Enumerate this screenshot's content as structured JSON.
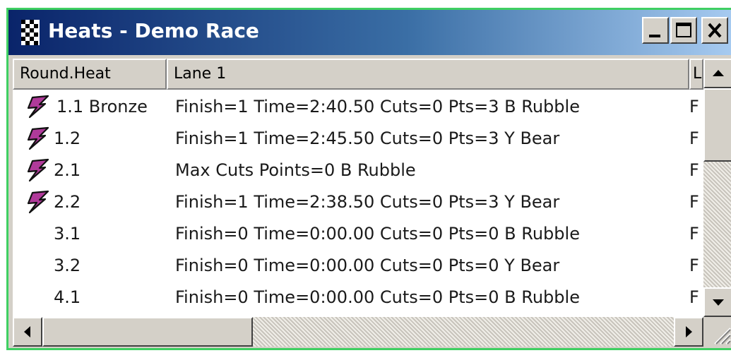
{
  "window": {
    "title": "Heats - Demo Race"
  },
  "columns": [
    "Round.Heat",
    "Lane 1",
    "L"
  ],
  "rows": [
    {
      "round_heat": "1.1 Bronze",
      "lane1": "Finish=1 Time=2:40.50 Cuts=0 Pts=3 B Rubble",
      "lane2": "F",
      "has_icon": true
    },
    {
      "round_heat": "1.2",
      "lane1": "Finish=1 Time=2:45.50 Cuts=0 Pts=3 Y Bear",
      "lane2": "F",
      "has_icon": true
    },
    {
      "round_heat": "2.1",
      "lane1": "Max Cuts  Points=0 B Rubble",
      "lane2": "F",
      "has_icon": true
    },
    {
      "round_heat": "2.2",
      "lane1": "Finish=1 Time=2:38.50 Cuts=0 Pts=3 Y Bear",
      "lane2": "F",
      "has_icon": true
    },
    {
      "round_heat": "3.1",
      "lane1": "Finish=0 Time=0:00.00 Cuts=0 Pts=0 B Rubble",
      "lane2": "F",
      "has_icon": false
    },
    {
      "round_heat": "3.2",
      "lane1": "Finish=0 Time=0:00.00 Cuts=0 Pts=0 Y Bear",
      "lane2": "F",
      "has_icon": false
    },
    {
      "round_heat": "4.1",
      "lane1": "Finish=0 Time=0:00.00 Cuts=0 Pts=0 B Rubble",
      "lane2": "F",
      "has_icon": false
    }
  ],
  "icons": {
    "app": "checkered-flag-icon",
    "row": "lightning-bolt-icon",
    "minimize": "minimize-icon",
    "maximize": "maximize-icon",
    "close": "close-icon"
  },
  "colors": {
    "title_bar_start": "#0a246a",
    "title_bar_end": "#a6caf0",
    "window_border": "#3fcf62",
    "row_icon": "#b03a9a"
  }
}
